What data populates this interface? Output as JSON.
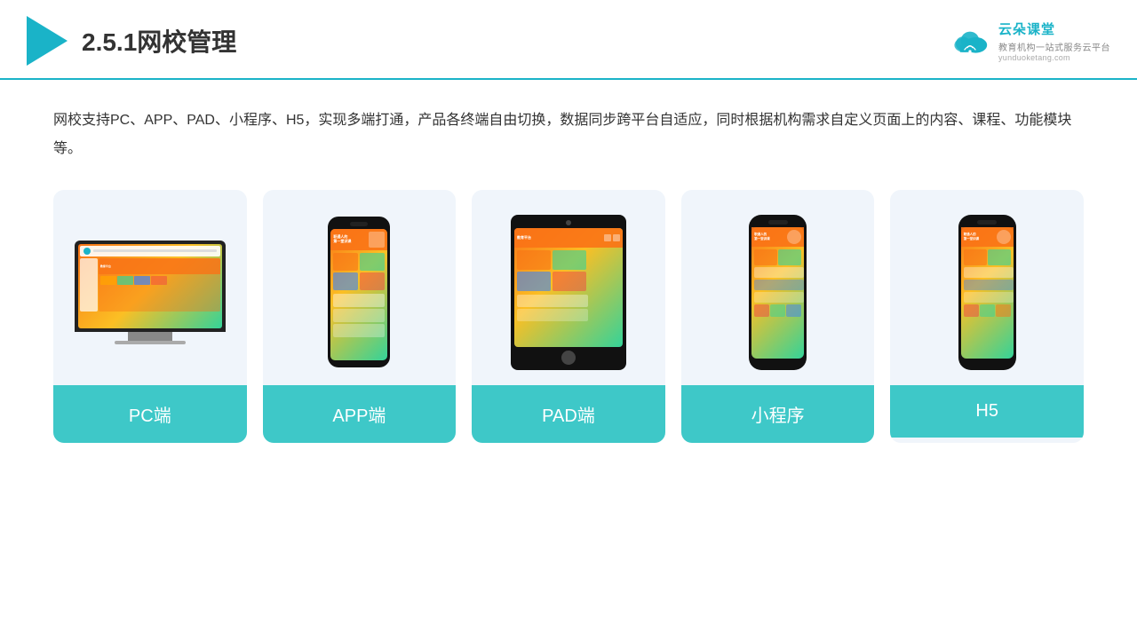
{
  "header": {
    "title": "2.5.1网校管理",
    "brand_name": "云朵课堂",
    "brand_sub": "教育机构一站式服务云平台",
    "brand_url": "yunduoketang.com"
  },
  "description": "网校支持PC、APP、PAD、小程序、H5，实现多端打通，产品各终端自由切换，数据同步跨平台自适应，同时根据机构需求自定义页面上的内容、课程、功能模块等。",
  "cards": [
    {
      "id": "pc",
      "label": "PC端"
    },
    {
      "id": "app",
      "label": "APP端"
    },
    {
      "id": "pad",
      "label": "PAD端"
    },
    {
      "id": "miniprogram",
      "label": "小程序"
    },
    {
      "id": "h5",
      "label": "H5"
    }
  ],
  "accent_color": "#3ec8c8",
  "bg_color": "#f0f5fb"
}
